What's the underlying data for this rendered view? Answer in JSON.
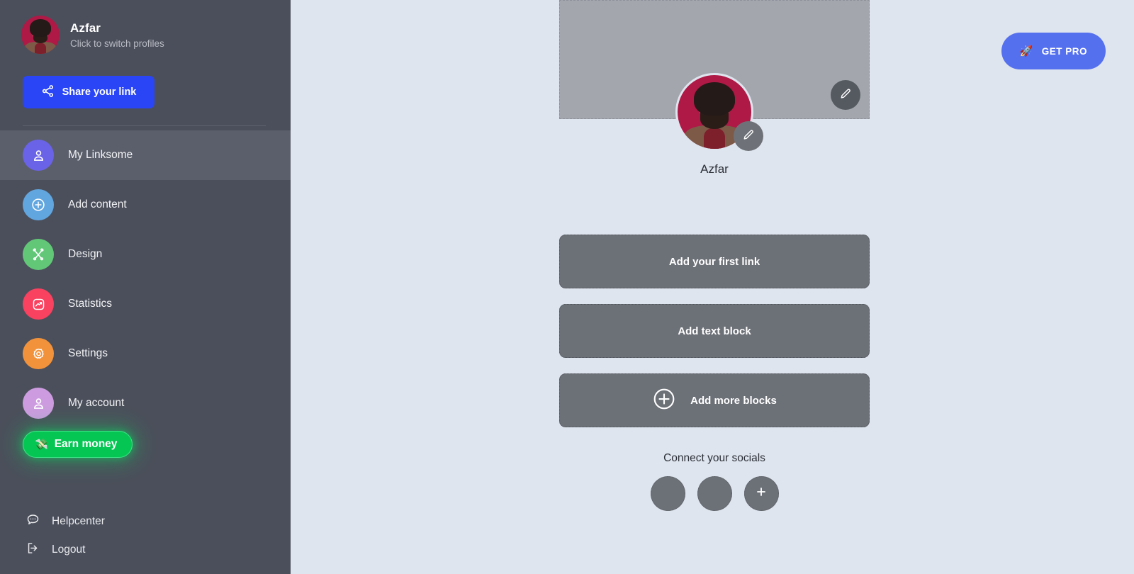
{
  "sidebar": {
    "profile": {
      "name": "Azfar",
      "subtitle": "Click to switch profiles",
      "avatar_icon": "user-photo-avatar"
    },
    "share_button": {
      "label": "Share your link",
      "icon": "share-nodes-icon",
      "color": "#2945f5"
    },
    "nav_items": [
      {
        "label": "My Linksome",
        "icon": "user-icon",
        "color": "#6a63e8",
        "active": true
      },
      {
        "label": "Add content",
        "icon": "plus-circle-icon",
        "color": "#62a6e0",
        "active": false
      },
      {
        "label": "Design",
        "icon": "pen-brush-icon",
        "color": "#62c878",
        "active": false
      },
      {
        "label": "Statistics",
        "icon": "chart-frame-icon",
        "color": "#f8425f",
        "active": false
      },
      {
        "label": "Settings",
        "icon": "gear-icon",
        "color": "#f2933c",
        "active": false
      },
      {
        "label": "My account",
        "icon": "user-icon",
        "color": "#cd9ce0",
        "active": false
      }
    ],
    "earn_money": {
      "label": "Earn money",
      "icon": "money-flying-icon",
      "color": "#05c653"
    },
    "bottom_items": [
      {
        "label": "Helpcenter",
        "icon": "chat-bubble-icon"
      },
      {
        "label": "Logout",
        "icon": "logout-arrow-icon"
      }
    ]
  },
  "main": {
    "get_pro": {
      "label": "GET PRO",
      "icon": "rocket-icon",
      "color": "#5570ee"
    },
    "preview": {
      "cover_edit_icon": "pencil-icon",
      "avatar_edit_icon": "pencil-icon",
      "profile_name": "Azfar"
    },
    "blocks": [
      {
        "label": "Add your first link",
        "icon": ""
      },
      {
        "label": "Add text block",
        "icon": ""
      },
      {
        "label": "Add more blocks",
        "icon": "plus-circle-icon"
      }
    ],
    "socials": {
      "title": "Connect your socials",
      "items": [
        {
          "icon": ""
        },
        {
          "icon": ""
        },
        {
          "icon": "plus-icon"
        }
      ]
    }
  }
}
